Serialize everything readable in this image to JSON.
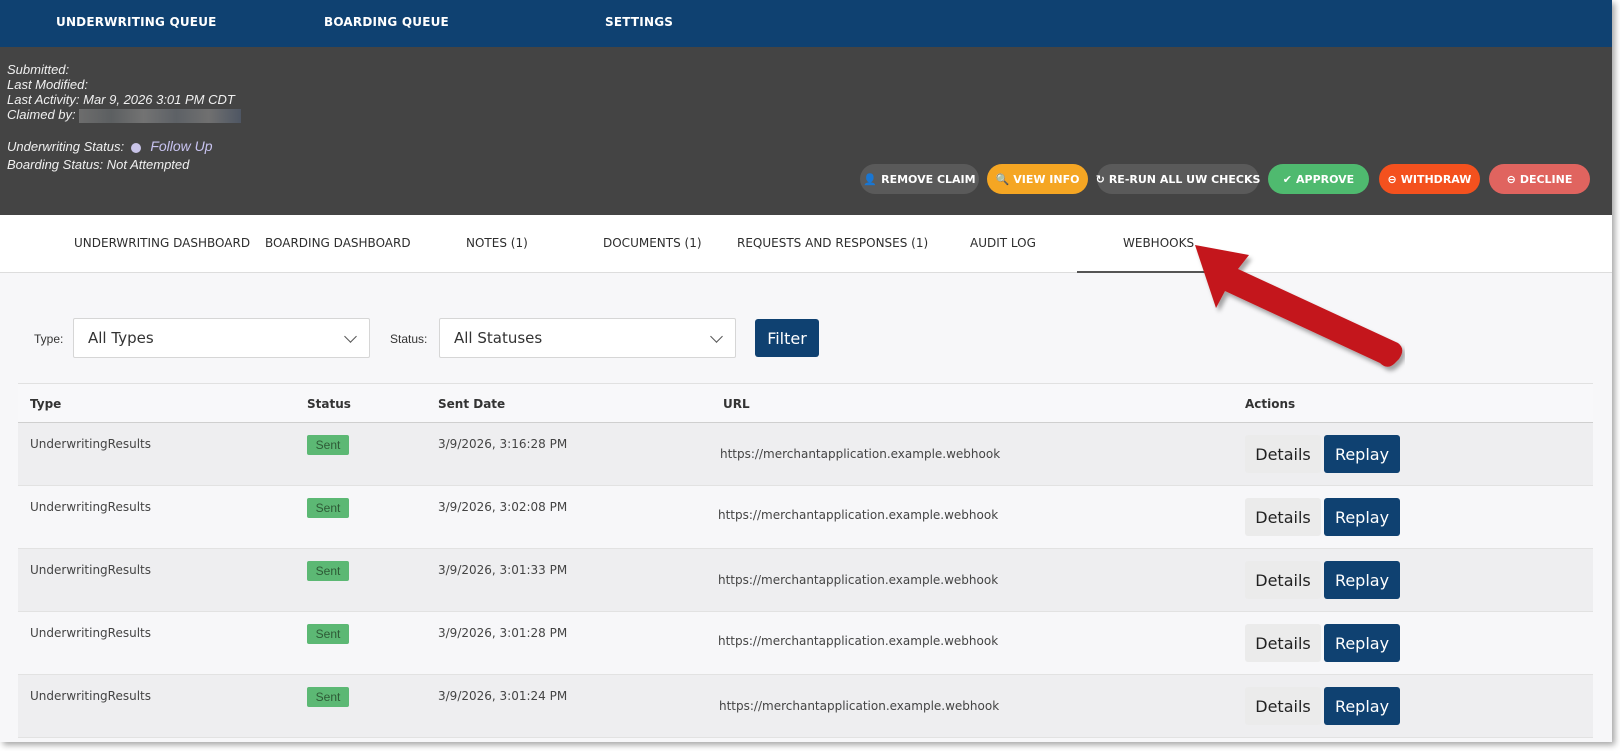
{
  "topnav": {
    "items": [
      "UNDERWRITING QUEUE",
      "BOARDING QUEUE",
      "SETTINGS"
    ]
  },
  "info": {
    "submitted_label": "Submitted:",
    "last_modified_label": "Last Modified:",
    "last_activity_label": "Last Activity:",
    "last_activity_value": "Mar 9, 2026 3:01 PM CDT",
    "claimed_by_label": "Claimed by:",
    "uw_status_label": "Underwriting Status:",
    "uw_status_value": "Follow Up",
    "boarding_status_label": "Boarding Status:",
    "boarding_status_value": "Not Attempted"
  },
  "actions": [
    {
      "label": "REMOVE CLAIM",
      "icon": "user-remove-icon",
      "glyph": "👤",
      "color": "#5a5a5a"
    },
    {
      "label": "VIEW INFO",
      "icon": "search-icon",
      "glyph": "🔍",
      "color": "#f5a623"
    },
    {
      "label": "RE-RUN ALL UW CHECKS",
      "icon": "refresh-icon",
      "glyph": "↻",
      "color": "#5a5a5a"
    },
    {
      "label": "APPROVE",
      "icon": "check-icon",
      "glyph": "✔",
      "color": "#4fba6f"
    },
    {
      "label": "WITHDRAW",
      "icon": "minus-circle-icon",
      "glyph": "⊖",
      "color": "#f4511e"
    },
    {
      "label": "DECLINE",
      "icon": "minus-circle-icon",
      "glyph": "⊖",
      "color": "#e0645f"
    }
  ],
  "tabs": [
    "UNDERWRITING DASHBOARD",
    "BOARDING DASHBOARD",
    "NOTES (1)",
    "DOCUMENTS (1)",
    "REQUESTS AND RESPONSES (1)",
    "AUDIT LOG",
    "WEBHOOKS"
  ],
  "active_tab": "WEBHOOKS",
  "filters": {
    "type_label": "Type:",
    "type_value": "All Types",
    "status_label": "Status:",
    "status_value": "All Statuses",
    "filter_button": "Filter"
  },
  "table": {
    "headers": [
      "Type",
      "Status",
      "Sent Date",
      "URL",
      "Actions"
    ],
    "rows": [
      {
        "type": "UnderwritingResults",
        "status": "Sent",
        "sent_date": "3/9/2026, 3:16:28 PM",
        "url": "https://merchantapplication.example.webhook"
      },
      {
        "type": "UnderwritingResults",
        "status": "Sent",
        "sent_date": "3/9/2026, 3:02:08 PM",
        "url": "https://merchantapplication.example.webhook"
      },
      {
        "type": "UnderwritingResults",
        "status": "Sent",
        "sent_date": "3/9/2026, 3:01:33 PM",
        "url": "https://merchantapplication.example.webhook"
      },
      {
        "type": "UnderwritingResults",
        "status": "Sent",
        "sent_date": "3/9/2026, 3:01:28 PM",
        "url": "https://merchantapplication.example.webhook"
      },
      {
        "type": "UnderwritingResults",
        "status": "Sent",
        "sent_date": "3/9/2026, 3:01:24 PM",
        "url": "https://merchantapplication.example.webhook"
      }
    ],
    "details_label": "Details",
    "replay_label": "Replay"
  },
  "colors": {
    "brand": "#0f4171",
    "header_bg": "#444444",
    "arrow": "#c4141a",
    "sent_badge": "#5cb874"
  }
}
